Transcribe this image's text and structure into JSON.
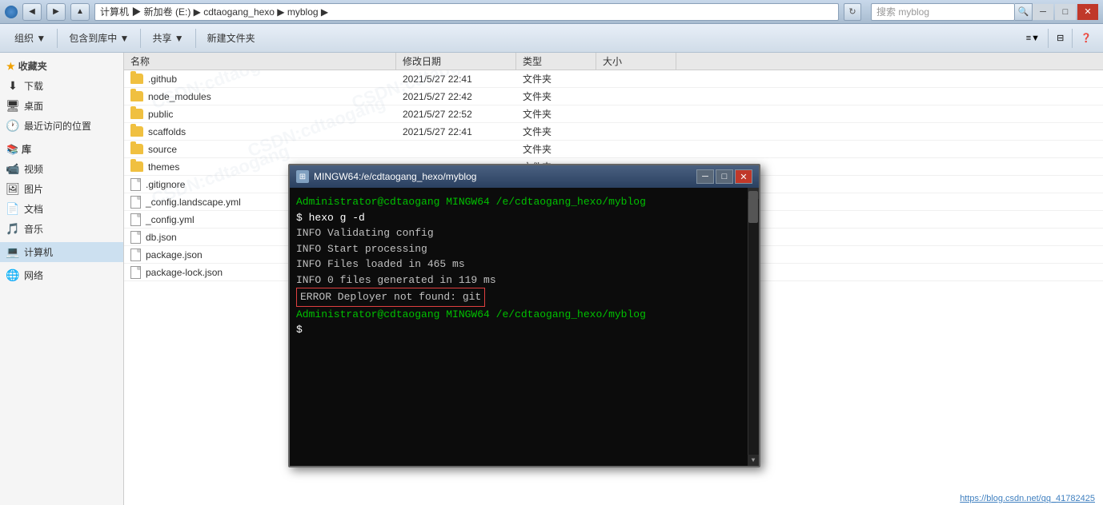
{
  "window": {
    "title": "myblog",
    "title_bar": {
      "address": "计算机 ▶ 新加卷 (E:) ▶ cdtaogang_hexo ▶ myblog ▶",
      "search_placeholder": "搜索 myblog",
      "min_label": "─",
      "max_label": "□",
      "close_label": "✕"
    }
  },
  "toolbar": {
    "organize_label": "组织 ▼",
    "include_label": "包含到库中 ▼",
    "share_label": "共享 ▼",
    "new_folder_label": "新建文件夹"
  },
  "columns": {
    "name": "名称",
    "date": "修改日期",
    "type": "类型",
    "size": "大小"
  },
  "sidebar": {
    "favorites_label": "收藏夹",
    "favorites_icon": "★",
    "items": [
      {
        "label": "下载",
        "icon": "⬇"
      },
      {
        "label": "桌面",
        "icon": "🖥"
      },
      {
        "label": "最近访问的位置",
        "icon": "🕐"
      }
    ],
    "library_label": "库",
    "library_items": [
      {
        "label": "视频",
        "icon": "📹"
      },
      {
        "label": "图片",
        "icon": "🖼"
      },
      {
        "label": "文档",
        "icon": "📄"
      },
      {
        "label": "音乐",
        "icon": "🎵"
      }
    ],
    "computer_label": "计算机",
    "network_label": "网络"
  },
  "files": [
    {
      "name": ".github",
      "date": "2021/5/27 22:41",
      "type": "文件夹",
      "size": "",
      "is_folder": true
    },
    {
      "name": "node_modules",
      "date": "2021/5/27 22:42",
      "type": "文件夹",
      "size": "",
      "is_folder": true
    },
    {
      "name": "public",
      "date": "2021/5/27 22:52",
      "type": "文件夹",
      "size": "",
      "is_folder": true
    },
    {
      "name": "scaffolds",
      "date": "2021/5/27 22:41",
      "type": "文件夹",
      "size": "",
      "is_folder": true
    },
    {
      "name": "source",
      "date": "",
      "type": "文件夹",
      "size": "",
      "is_folder": true
    },
    {
      "name": "themes",
      "date": "",
      "type": "文件夹",
      "size": "",
      "is_folder": true
    },
    {
      "name": ".gitignore",
      "date": "",
      "type": "",
      "size": "",
      "is_folder": false
    },
    {
      "name": "_config.landscape.yml",
      "date": "",
      "type": "",
      "size": "",
      "is_folder": false
    },
    {
      "name": "_config.yml",
      "date": "",
      "type": "",
      "size": "",
      "is_folder": false
    },
    {
      "name": "db.json",
      "date": "",
      "type": "",
      "size": "",
      "is_folder": false
    },
    {
      "name": "package.json",
      "date": "",
      "type": "",
      "size": "",
      "is_folder": false
    },
    {
      "name": "package-lock.json",
      "date": "",
      "type": "",
      "size": "",
      "is_folder": false
    }
  ],
  "terminal": {
    "title": "MINGW64:/e/cdtaogang_hexo/myblog",
    "lines": [
      {
        "text": "Administrator@cdtaogang MINGW64 /e/cdtaogang_hexo/myblog",
        "class": "t-green"
      },
      {
        "text": "$ hexo g -d",
        "class": "t-white"
      },
      {
        "text": "INFO  Validating config",
        "class": ""
      },
      {
        "text": "INFO  Start processing",
        "class": ""
      },
      {
        "text": "INFO  Files loaded in 465 ms",
        "class": ""
      },
      {
        "text": "INFO  0 files generated in 119 ms",
        "class": ""
      },
      {
        "text": "ERROR Deployer not found: git",
        "class": "error"
      },
      {
        "text": "",
        "class": ""
      },
      {
        "text": "Administrator@cdtaogang MINGW64 /e/cdtaogang_hexo/myblog",
        "class": "t-green"
      },
      {
        "text": "$ ",
        "class": "t-white"
      }
    ]
  },
  "watermarks": [
    "CSDN:cdtaogang",
    "CSDN:cdtaogang",
    "CSDN:cdtaogang",
    "CSDN:cdtaogang",
    "CSDN:cdtaogang",
    "CSDN:cdtaogang"
  ],
  "bottom_link": "https://blog.csdn.net/qq_41782425"
}
